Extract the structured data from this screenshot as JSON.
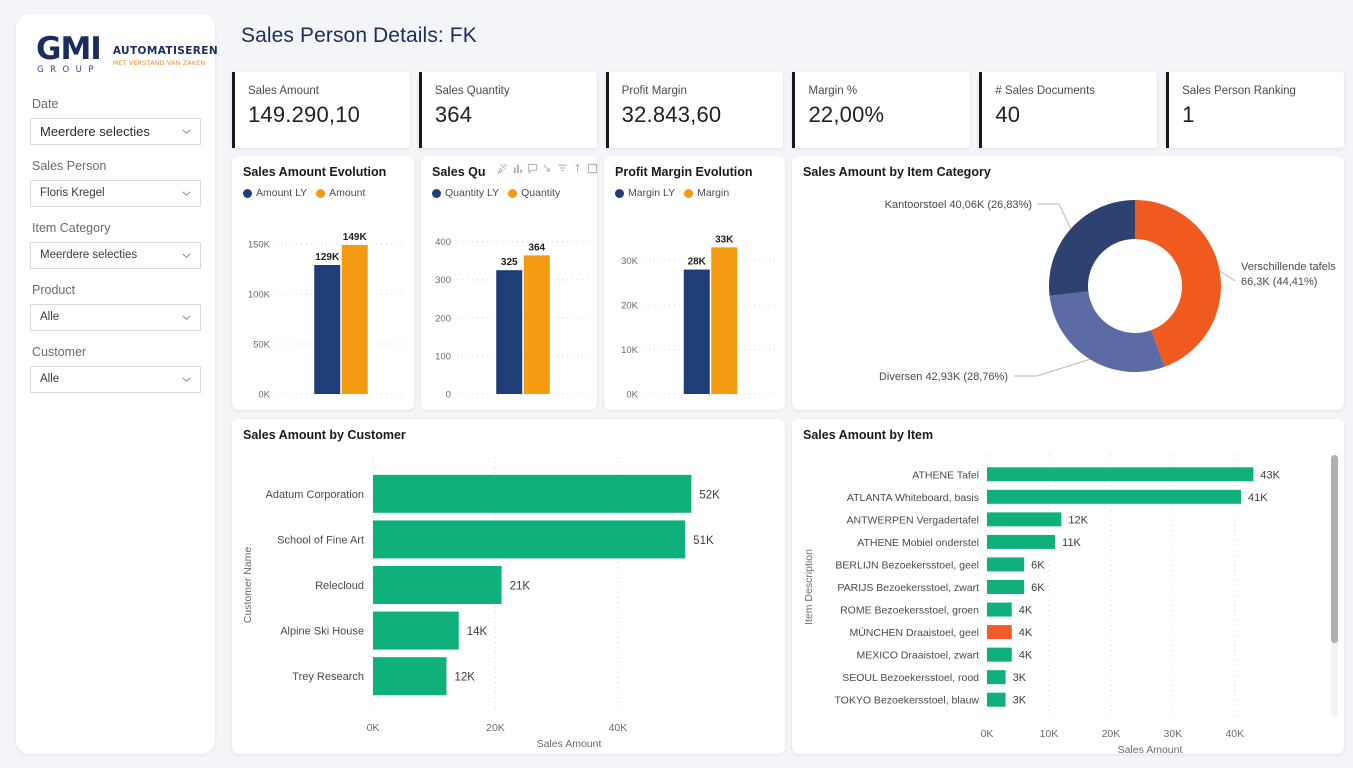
{
  "brand": {
    "logo_main": "GMI",
    "logo_sub": "GROUP",
    "logo_right_top": "AUTOMATISEREN",
    "logo_right_bottom": "MET VERSTAND VAN ZAKEN",
    "navy": "#1b2c5e",
    "orange": "#ef8a1e"
  },
  "header": {
    "title": "Sales Person Details: FK"
  },
  "sidebar": {
    "slicers": [
      {
        "label": "Date",
        "value": "Meerdere selecties",
        "icon": "chevron-down-icon"
      },
      {
        "label": "Sales Person",
        "value": "Floris Kregel",
        "icon": "chevron-down-icon"
      },
      {
        "label": "Item Category",
        "value": "Meerdere selecties",
        "icon": "chevron-down-icon"
      },
      {
        "label": "Product",
        "value": "Alle",
        "icon": "chevron-down-icon"
      },
      {
        "label": "Customer",
        "value": "Alle",
        "icon": "chevron-down-icon"
      }
    ]
  },
  "kpis": [
    {
      "label": "Sales Amount",
      "value": "149.290,10"
    },
    {
      "label": "Sales Quantity",
      "value": "364"
    },
    {
      "label": "Profit Margin",
      "value": "32.843,60"
    },
    {
      "label": "Margin %",
      "value": "22,00%"
    },
    {
      "label": "# Sales Documents",
      "value": "40"
    },
    {
      "label": "Sales Person Ranking",
      "value": "1"
    }
  ],
  "visual_toolbar": {
    "icons": [
      "pin-icon",
      "drill-up-icon",
      "comment-icon",
      "drill-down-icon",
      "filter-icon",
      "drill-mode-icon",
      "focus-mode-icon"
    ],
    "more_label": "⋯"
  },
  "colors": {
    "series_ly": "#1f3d77",
    "series_cy": "#f59b11",
    "green": "#10b07c",
    "highlight": "#f15a2b",
    "donut_orange": "#f05a1e",
    "donut_navy": "#2e4272",
    "donut_slate": "#5d6ba5"
  },
  "chart_data": [
    {
      "type": "bar",
      "id": "sales-amount-evolution",
      "title": "Sales Amount Evolution",
      "categories": [
        ""
      ],
      "series": [
        {
          "name": "Amount LY",
          "values": [
            129000
          ],
          "label": "129K",
          "color": "#1f3d77"
        },
        {
          "name": "Amount",
          "values": [
            149000
          ],
          "label": "149K",
          "color": "#f59b11"
        }
      ],
      "ylim": [
        0,
        160000
      ],
      "yticks": [
        0,
        50000,
        100000,
        150000
      ],
      "yticklabels": [
        "0K",
        "50K",
        "100K",
        "150K"
      ],
      "xlabel": "",
      "ylabel": "",
      "grid": true,
      "legend": "top"
    },
    {
      "type": "bar",
      "id": "sales-quantity-evolution",
      "title": "Sales Qu",
      "title_full": "Sales Quantity Evolution",
      "categories": [
        ""
      ],
      "series": [
        {
          "name": "Quantity LY",
          "values": [
            325
          ],
          "label": "325",
          "color": "#1f3d77"
        },
        {
          "name": "Quantity",
          "values": [
            364
          ],
          "label": "364",
          "color": "#f59b11"
        }
      ],
      "ylim": [
        0,
        420
      ],
      "yticks": [
        0,
        100,
        200,
        300,
        400
      ],
      "yticklabels": [
        "0",
        "100",
        "200",
        "300",
        "400"
      ],
      "xlabel": "",
      "ylabel": "",
      "grid": true,
      "legend": "top"
    },
    {
      "type": "bar",
      "id": "profit-margin-evolution",
      "title": "Profit Margin Evolution",
      "categories": [
        ""
      ],
      "series": [
        {
          "name": "Margin LY",
          "values": [
            28000
          ],
          "label": "28K",
          "color": "#1f3d77"
        },
        {
          "name": "Margin",
          "values": [
            33000
          ],
          "label": "33K",
          "color": "#f59b11"
        }
      ],
      "ylim": [
        0,
        36000
      ],
      "yticks": [
        0,
        10000,
        20000,
        30000
      ],
      "yticklabels": [
        "0K",
        "10K",
        "20K",
        "30K"
      ],
      "xlabel": "",
      "ylabel": "",
      "grid": true,
      "legend": "top"
    },
    {
      "type": "pie",
      "id": "sales-amount-by-item-category",
      "title": "Sales Amount by Item Category",
      "donut": true,
      "slices": [
        {
          "label": "Verschillende tafels",
          "value": 66.3,
          "unit": "K",
          "percent": 44.41,
          "annotation": "Verschillende tafels 66,3K (44,41%)",
          "color": "#f05a1e"
        },
        {
          "label": "Diversen",
          "value": 42.93,
          "unit": "K",
          "percent": 28.76,
          "annotation": "Diversen 42,93K (28,76%)",
          "color": "#5d6ba5"
        },
        {
          "label": "Kantoorstoel",
          "value": 40.06,
          "unit": "K",
          "percent": 26.83,
          "annotation": "Kantoorstoel 40,06K (26,83%)",
          "color": "#2e4272"
        }
      ],
      "legend": "none"
    },
    {
      "type": "bar",
      "id": "sales-amount-by-customer",
      "orientation": "horizontal",
      "title": "Sales Amount by Customer",
      "categories": [
        "Adatum Corporation",
        "School of Fine Art",
        "Relecloud",
        "Alpine Ski House",
        "Trey Research"
      ],
      "values": [
        52000,
        51000,
        21000,
        14000,
        12000
      ],
      "datalabels": [
        "52K",
        "51K",
        "21K",
        "14K",
        "12K"
      ],
      "xlabel": "Sales Amount",
      "ylabel": "Customer Name",
      "xticks": [
        0,
        20000,
        40000
      ],
      "xticklabels": [
        "0K",
        "20K",
        "40K"
      ],
      "xlim": [
        0,
        57000
      ],
      "grid": true,
      "legend": "none",
      "color": "#10b07c"
    },
    {
      "type": "bar",
      "id": "sales-amount-by-item",
      "orientation": "horizontal",
      "title": "Sales Amount by Item",
      "categories": [
        "ATHENE Tafel",
        "ATLANTA Whiteboard, basis",
        "ANTWERPEN Vergadertafel",
        "ATHENE Mobiel onderstel",
        "BERLIJN Bezoekersstoel, geel",
        "PARIJS Bezoekersstoel, zwart",
        "ROME Bezoekersstoel, groen",
        "MÜNCHEN Draaistoel, geel",
        "MEXICO Draaistoel, zwart",
        "SEOUL Bezoekersstoel, rood",
        "TOKYO Bezoekersstoel, blauw"
      ],
      "values": [
        43000,
        41000,
        12000,
        11000,
        6000,
        6000,
        4000,
        4000,
        4000,
        3000,
        3000
      ],
      "datalabels": [
        "43K",
        "41K",
        "12K",
        "11K",
        "6K",
        "6K",
        "4K",
        "4K",
        "4K",
        "3K",
        "3K"
      ],
      "highlighted": [
        "MÜNCHEN Draaistoel, geel"
      ],
      "xlabel": "Sales Amount",
      "ylabel": "Item Description",
      "xticks": [
        0,
        10000,
        20000,
        30000,
        40000
      ],
      "xticklabels": [
        "0K",
        "10K",
        "20K",
        "30K",
        "40K"
      ],
      "xlim": [
        0,
        46000
      ],
      "grid": true,
      "legend": "none",
      "color": "#10b07c",
      "highlight_color": "#f15a2b",
      "scrollable": true
    }
  ]
}
